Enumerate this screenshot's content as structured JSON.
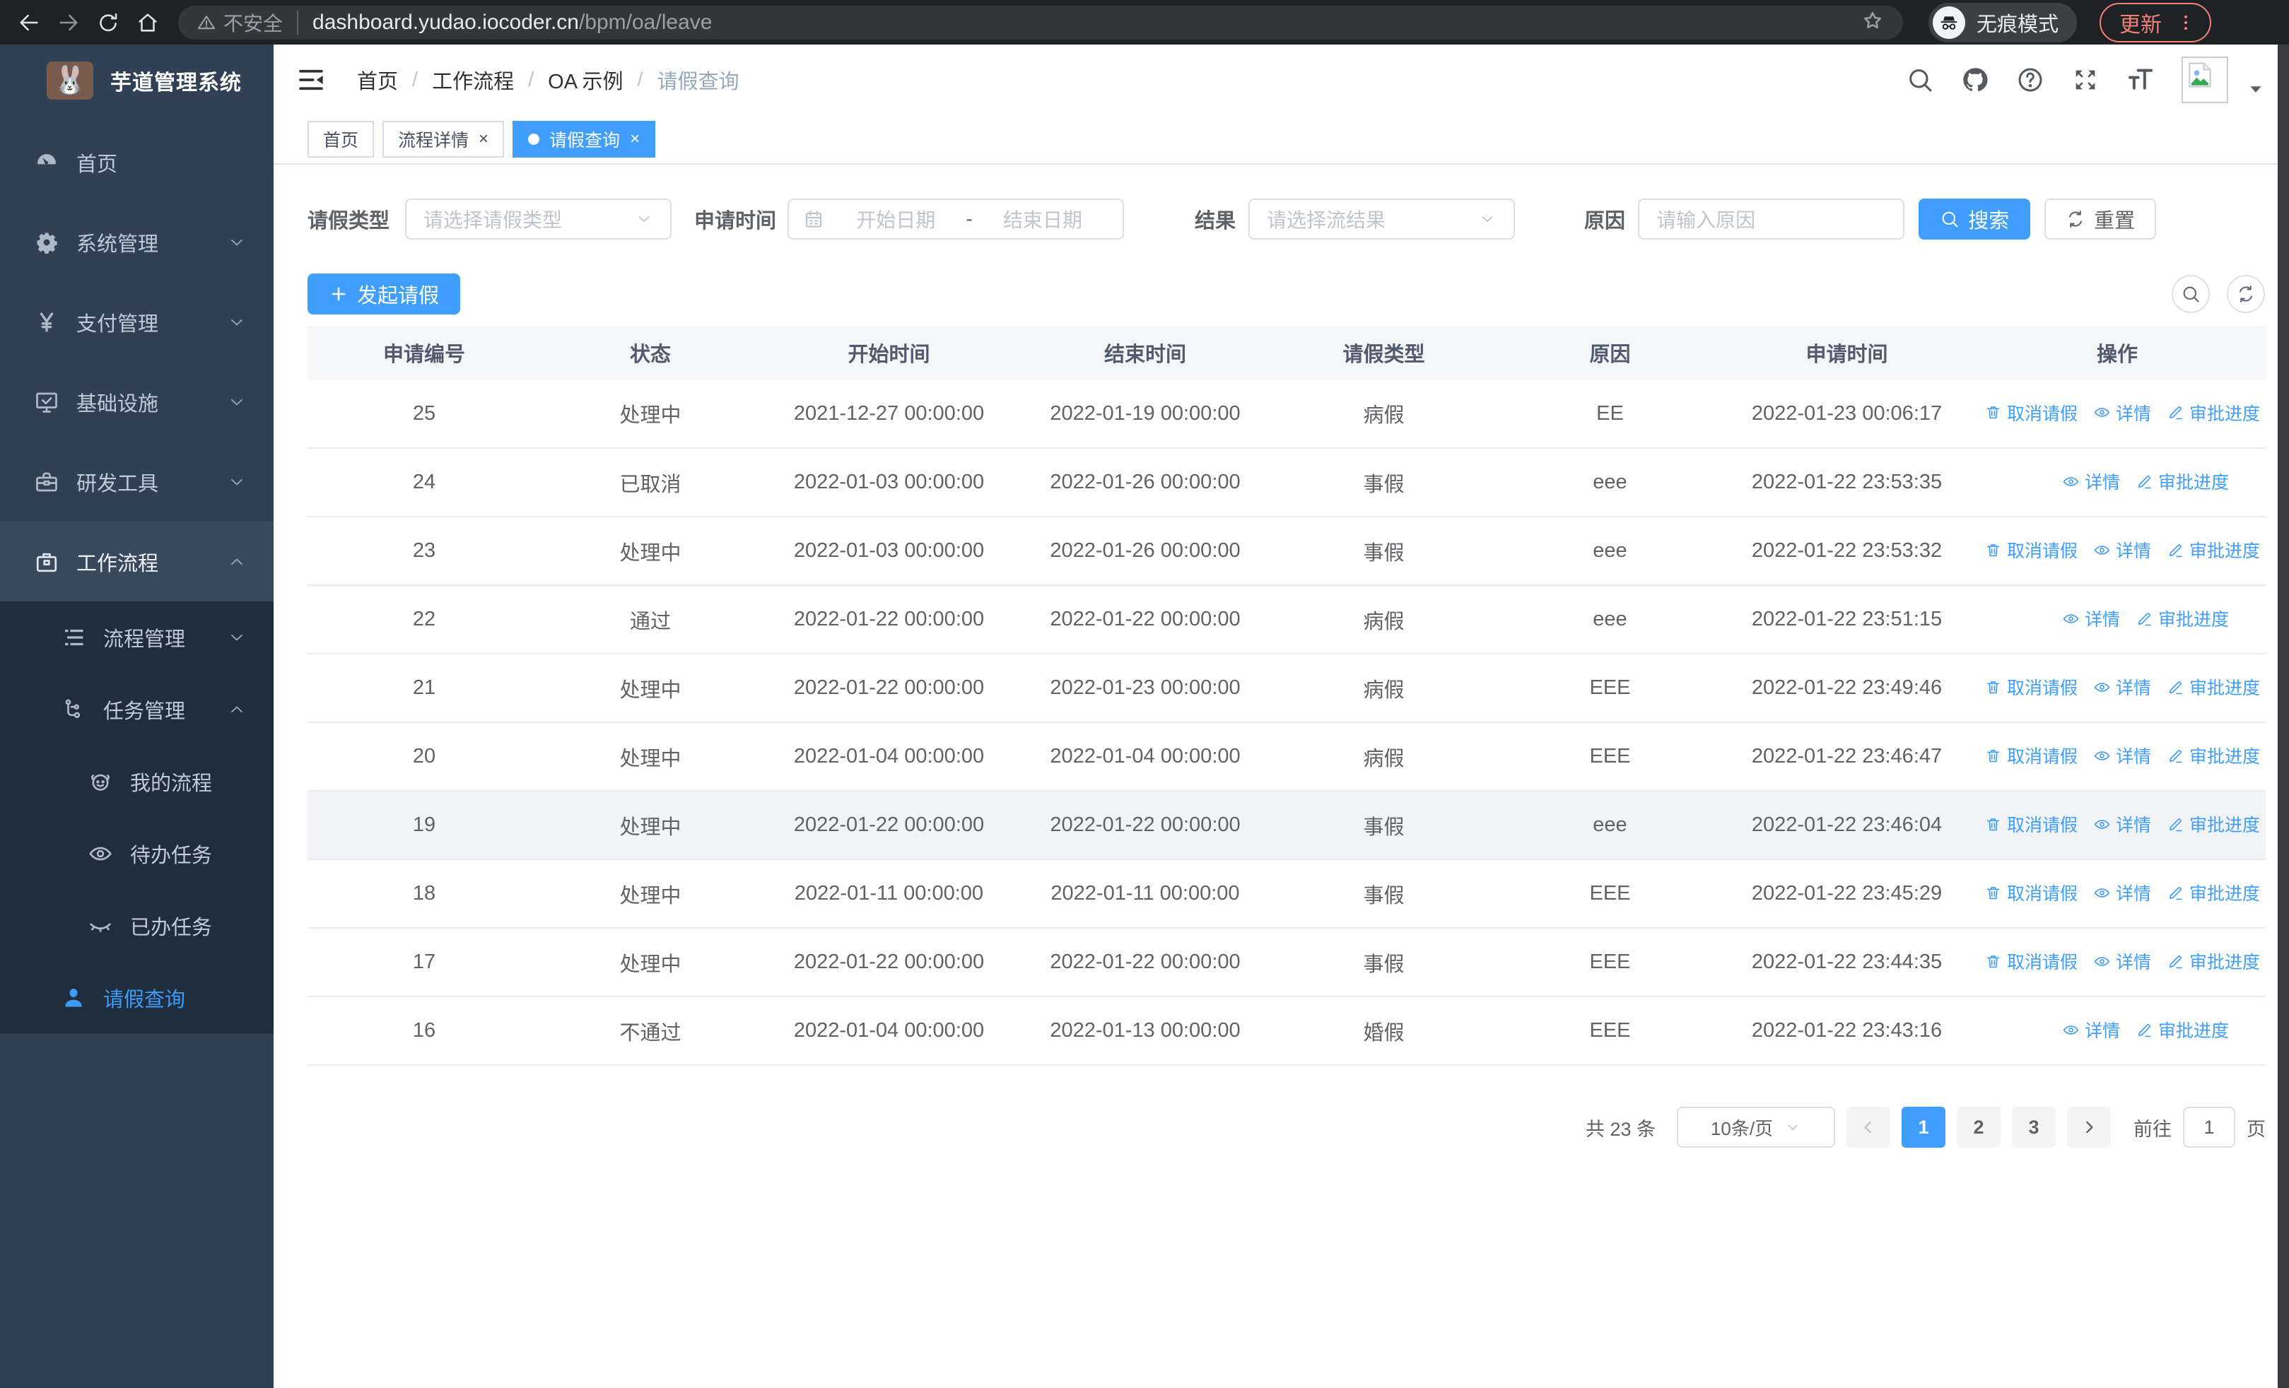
{
  "browser": {
    "security_label": "不安全",
    "url_host": "dashboard.yudao.iocoder.cn",
    "url_path": "/bpm/oa/leave",
    "incognito_label": "无痕模式",
    "update_label": "更新"
  },
  "colors": {
    "primary": "#409EFF",
    "sidebar_bg": "#304156",
    "submenu_bg": "#1f2d3d",
    "chrome_bg": "#202124",
    "update_accent": "#ee827a"
  },
  "sidebar": {
    "app_title": "芋道管理系统",
    "logo_glyph": "🐰",
    "menu": [
      {
        "name": "home",
        "label": "首页",
        "icon": "dashboard-icon",
        "level": 1,
        "chevron": null,
        "sub": false,
        "active": false,
        "highlighted": false
      },
      {
        "name": "system-management",
        "label": "系统管理",
        "icon": "gear-icon",
        "level": 1,
        "chevron": "down",
        "sub": false,
        "active": false,
        "highlighted": false
      },
      {
        "name": "payment-management",
        "label": "支付管理",
        "icon": "yen-icon",
        "level": 1,
        "chevron": "down",
        "sub": false,
        "active": false,
        "highlighted": false
      },
      {
        "name": "infrastructure",
        "label": "基础设施",
        "icon": "monitor-icon",
        "level": 1,
        "chevron": "down",
        "sub": false,
        "active": false,
        "highlighted": false
      },
      {
        "name": "dev-tools",
        "label": "研发工具",
        "icon": "toolbox-icon",
        "level": 1,
        "chevron": "down",
        "sub": false,
        "active": false,
        "highlighted": false
      },
      {
        "name": "workflow",
        "label": "工作流程",
        "icon": "briefcase-icon",
        "level": 1,
        "chevron": "up",
        "sub": false,
        "active": false,
        "highlighted": true
      },
      {
        "name": "process-management",
        "label": "流程管理",
        "icon": "list-icon",
        "level": 2,
        "chevron": "down",
        "sub": true,
        "active": false,
        "highlighted": false
      },
      {
        "name": "task-management",
        "label": "任务管理",
        "icon": "flow-icon",
        "level": 2,
        "chevron": "up",
        "sub": true,
        "active": false,
        "highlighted": false
      },
      {
        "name": "my-process",
        "label": "我的流程",
        "icon": "face-icon",
        "level": 3,
        "chevron": null,
        "sub": true,
        "active": false,
        "highlighted": false
      },
      {
        "name": "todo-tasks",
        "label": "待办任务",
        "icon": "eye-icon",
        "level": 3,
        "chevron": null,
        "sub": true,
        "active": false,
        "highlighted": false
      },
      {
        "name": "done-tasks",
        "label": "已办任务",
        "icon": "eye-closed-icon",
        "level": 3,
        "chevron": null,
        "sub": true,
        "active": false,
        "highlighted": false
      },
      {
        "name": "leave-query",
        "label": "请假查询",
        "icon": "person-icon",
        "level": 2,
        "chevron": null,
        "sub": true,
        "active": true,
        "highlighted": false
      }
    ]
  },
  "breadcrumb": {
    "items": [
      "首页",
      "工作流程",
      "OA 示例",
      "请假查询"
    ]
  },
  "tabs": [
    {
      "name": "home",
      "label": "首页",
      "closable": false,
      "active": false
    },
    {
      "name": "process-detail",
      "label": "流程详情",
      "closable": true,
      "active": false
    },
    {
      "name": "leave-query",
      "label": "请假查询",
      "closable": true,
      "active": true
    }
  ],
  "filters": {
    "leave_type_label": "请假类型",
    "leave_type_placeholder": "请选择请假类型",
    "apply_time_label": "申请时间",
    "start_date_placeholder": "开始日期",
    "range_separator": "-",
    "end_date_placeholder": "结束日期",
    "result_label": "结果",
    "result_placeholder": "请选择流结果",
    "reason_label": "原因",
    "reason_placeholder": "请输入原因",
    "search_label": "搜索",
    "reset_label": "重置"
  },
  "toolbar": {
    "create_label": "发起请假"
  },
  "table": {
    "columns": [
      "申请编号",
      "状态",
      "开始时间",
      "结束时间",
      "请假类型",
      "原因",
      "申请时间",
      "操作"
    ],
    "rows": [
      {
        "id": "25",
        "status": "处理中",
        "start": "2021-12-27 00:00:00",
        "end": "2022-01-19 00:00:00",
        "type": "病假",
        "reason": "EE",
        "apply_time": "2022-01-23 00:06:17",
        "highlighted": false,
        "actions": [
          {
            "label": "取消请假",
            "icon": "trash-icon"
          },
          {
            "label": "详情",
            "icon": "detail-eye-icon"
          },
          {
            "label": "审批进度",
            "icon": "pen-icon"
          }
        ]
      },
      {
        "id": "24",
        "status": "已取消",
        "start": "2022-01-03 00:00:00",
        "end": "2022-01-26 00:00:00",
        "type": "事假",
        "reason": "eee",
        "apply_time": "2022-01-22 23:53:35",
        "highlighted": false,
        "actions": [
          {
            "label": "详情",
            "icon": "detail-eye-icon"
          },
          {
            "label": "审批进度",
            "icon": "pen-icon"
          }
        ]
      },
      {
        "id": "23",
        "status": "处理中",
        "start": "2022-01-03 00:00:00",
        "end": "2022-01-26 00:00:00",
        "type": "事假",
        "reason": "eee",
        "apply_time": "2022-01-22 23:53:32",
        "highlighted": false,
        "actions": [
          {
            "label": "取消请假",
            "icon": "trash-icon"
          },
          {
            "label": "详情",
            "icon": "detail-eye-icon"
          },
          {
            "label": "审批进度",
            "icon": "pen-icon"
          }
        ]
      },
      {
        "id": "22",
        "status": "通过",
        "start": "2022-01-22 00:00:00",
        "end": "2022-01-22 00:00:00",
        "type": "病假",
        "reason": "eee",
        "apply_time": "2022-01-22 23:51:15",
        "highlighted": false,
        "actions": [
          {
            "label": "详情",
            "icon": "detail-eye-icon"
          },
          {
            "label": "审批进度",
            "icon": "pen-icon"
          }
        ]
      },
      {
        "id": "21",
        "status": "处理中",
        "start": "2022-01-22 00:00:00",
        "end": "2022-01-23 00:00:00",
        "type": "病假",
        "reason": "EEE",
        "apply_time": "2022-01-22 23:49:46",
        "highlighted": false,
        "actions": [
          {
            "label": "取消请假",
            "icon": "trash-icon"
          },
          {
            "label": "详情",
            "icon": "detail-eye-icon"
          },
          {
            "label": "审批进度",
            "icon": "pen-icon"
          }
        ]
      },
      {
        "id": "20",
        "status": "处理中",
        "start": "2022-01-04 00:00:00",
        "end": "2022-01-04 00:00:00",
        "type": "病假",
        "reason": "EEE",
        "apply_time": "2022-01-22 23:46:47",
        "highlighted": false,
        "actions": [
          {
            "label": "取消请假",
            "icon": "trash-icon"
          },
          {
            "label": "详情",
            "icon": "detail-eye-icon"
          },
          {
            "label": "审批进度",
            "icon": "pen-icon"
          }
        ]
      },
      {
        "id": "19",
        "status": "处理中",
        "start": "2022-01-22 00:00:00",
        "end": "2022-01-22 00:00:00",
        "type": "事假",
        "reason": "eee",
        "apply_time": "2022-01-22 23:46:04",
        "highlighted": true,
        "actions": [
          {
            "label": "取消请假",
            "icon": "trash-icon"
          },
          {
            "label": "详情",
            "icon": "detail-eye-icon"
          },
          {
            "label": "审批进度",
            "icon": "pen-icon"
          }
        ]
      },
      {
        "id": "18",
        "status": "处理中",
        "start": "2022-01-11 00:00:00",
        "end": "2022-01-11 00:00:00",
        "type": "事假",
        "reason": "EEE",
        "apply_time": "2022-01-22 23:45:29",
        "highlighted": false,
        "actions": [
          {
            "label": "取消请假",
            "icon": "trash-icon"
          },
          {
            "label": "详情",
            "icon": "detail-eye-icon"
          },
          {
            "label": "审批进度",
            "icon": "pen-icon"
          }
        ]
      },
      {
        "id": "17",
        "status": "处理中",
        "start": "2022-01-22 00:00:00",
        "end": "2022-01-22 00:00:00",
        "type": "事假",
        "reason": "EEE",
        "apply_time": "2022-01-22 23:44:35",
        "highlighted": false,
        "actions": [
          {
            "label": "取消请假",
            "icon": "trash-icon"
          },
          {
            "label": "详情",
            "icon": "detail-eye-icon"
          },
          {
            "label": "审批进度",
            "icon": "pen-icon"
          }
        ]
      },
      {
        "id": "16",
        "status": "不通过",
        "start": "2022-01-04 00:00:00",
        "end": "2022-01-13 00:00:00",
        "type": "婚假",
        "reason": "EEE",
        "apply_time": "2022-01-22 23:43:16",
        "highlighted": false,
        "actions": [
          {
            "label": "详情",
            "icon": "detail-eye-icon"
          },
          {
            "label": "审批进度",
            "icon": "pen-icon"
          }
        ]
      }
    ]
  },
  "pagination": {
    "total_label": "共 23 条",
    "page_size_label": "10条/页",
    "pages": [
      "1",
      "2",
      "3"
    ],
    "active_page": "1",
    "goto_label": "前往",
    "goto_value": "1",
    "unit_label": "页"
  }
}
